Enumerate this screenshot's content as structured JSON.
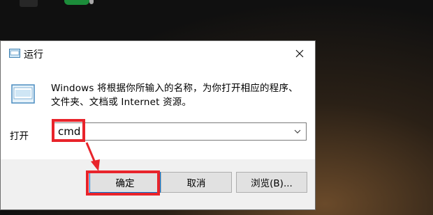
{
  "dialog": {
    "title": "运行",
    "description": "Windows 将根据你所输入的名称，为你打开相应的程序、文件夹、文档或 Internet 资源。",
    "open_label": "打开",
    "command_value": "cmd",
    "buttons": {
      "ok": "确定",
      "cancel": "取消",
      "browse": "浏览(B)..."
    }
  },
  "colors": {
    "annotation": "#e8242b",
    "button_focus": "#0078d7",
    "footer_bg": "#f0f0f0"
  }
}
